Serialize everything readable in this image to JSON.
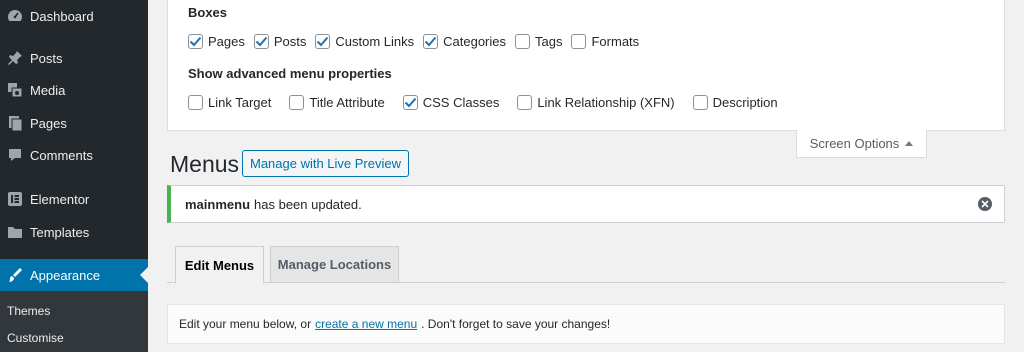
{
  "sidebar": {
    "items": [
      {
        "label": "Dashboard",
        "icon": "dashboard-icon"
      },
      {
        "label": "Posts",
        "icon": "pin-icon"
      },
      {
        "label": "Media",
        "icon": "media-icon"
      },
      {
        "label": "Pages",
        "icon": "pages-icon"
      },
      {
        "label": "Comments",
        "icon": "comments-icon"
      },
      {
        "label": "Elementor",
        "icon": "elementor-icon"
      },
      {
        "label": "Templates",
        "icon": "folder-icon"
      },
      {
        "label": "Appearance",
        "icon": "paintbrush-icon",
        "active": true
      }
    ],
    "submenu": [
      "Themes",
      "Customise"
    ],
    "colors": {
      "bg": "#23282d",
      "active": "#0073aa",
      "submenu_bg": "#32373c"
    }
  },
  "screen_options": {
    "boxes_heading": "Boxes",
    "boxes": [
      {
        "label": "Pages",
        "checked": true
      },
      {
        "label": "Posts",
        "checked": true
      },
      {
        "label": "Custom Links",
        "checked": true
      },
      {
        "label": "Categories",
        "checked": true
      },
      {
        "label": "Tags",
        "checked": false
      },
      {
        "label": "Formats",
        "checked": false
      }
    ],
    "advanced_heading": "Show advanced menu properties",
    "advanced": [
      {
        "label": "Link Target",
        "checked": false
      },
      {
        "label": "Title Attribute",
        "checked": false
      },
      {
        "label": "CSS Classes",
        "checked": true
      },
      {
        "label": "Link Relationship (XFN)",
        "checked": false
      },
      {
        "label": "Description",
        "checked": false
      }
    ],
    "tab_label": "Screen Options"
  },
  "header": {
    "title": "Menus",
    "live_preview_label": "Manage with Live Preview"
  },
  "notice": {
    "menu_name": "mainmenu",
    "message": "has been updated.",
    "accent": "#46b450"
  },
  "tabs": {
    "edit_menus": "Edit Menus",
    "manage_locations": "Manage Locations"
  },
  "edit_box": {
    "prefix": "Edit your menu below, or",
    "link": "create a new menu",
    "suffix": ". Don't forget to save your changes!"
  }
}
